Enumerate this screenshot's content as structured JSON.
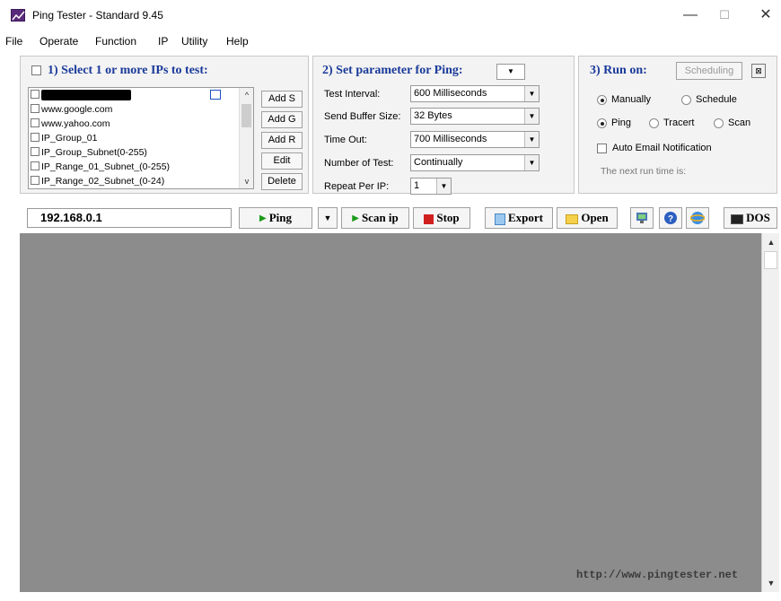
{
  "window": {
    "title": "Ping Tester - Standard  9.45",
    "minimize": "—",
    "maximize": "☐",
    "close": "✕"
  },
  "menu": [
    "File",
    "Operate",
    "Function",
    "IP",
    "Utility",
    "Help"
  ],
  "section1": {
    "title": "1) Select 1 or more IPs to test:",
    "ip_list": [
      "www.google.com",
      "www.yahoo.com",
      "IP_Group_01",
      "IP_Group_Subnet(0-255)",
      "IP_Range_01_Subnet_(0-255)",
      "IP_Range_02_Subnet_(0-24)"
    ],
    "buttons": [
      "Add S",
      "Add G",
      "Add R",
      "Edit",
      "Delete"
    ]
  },
  "section2": {
    "title": "2) Set parameter for Ping:",
    "params": [
      {
        "label": "Test Interval:",
        "value": "600  Milliseconds"
      },
      {
        "label": "Send Buffer Size:",
        "value": "32  Bytes"
      },
      {
        "label": "Time Out:",
        "value": "700  Milliseconds"
      },
      {
        "label": "Number of Test:",
        "value": "Continually"
      },
      {
        "label": "Repeat Per IP:",
        "value": "1"
      }
    ]
  },
  "section3": {
    "title": "3) Run on:",
    "scheduling_button": "Scheduling",
    "run_mode": {
      "manually": "Manually",
      "schedule": "Schedule",
      "selected": "manually"
    },
    "test_type": {
      "ping": "Ping",
      "tracert": "Tracert",
      "scan": "Scan",
      "selected": "ping"
    },
    "auto_email": "Auto Email Notification",
    "next_run": "The next run time is:"
  },
  "toolbar": {
    "ip_value": "192.168.0.1",
    "ping": "Ping",
    "scan_ip": "Scan ip",
    "stop": "Stop",
    "export": "Export",
    "open": "Open",
    "dos": "DOS"
  },
  "output": {
    "url": "http://www.pingtester.net"
  },
  "colors": {
    "section_title": "#1a3a9a",
    "output_bg": "#8c8c8c",
    "ping_green": "#1a9a1a",
    "stop_red": "#d02020"
  }
}
